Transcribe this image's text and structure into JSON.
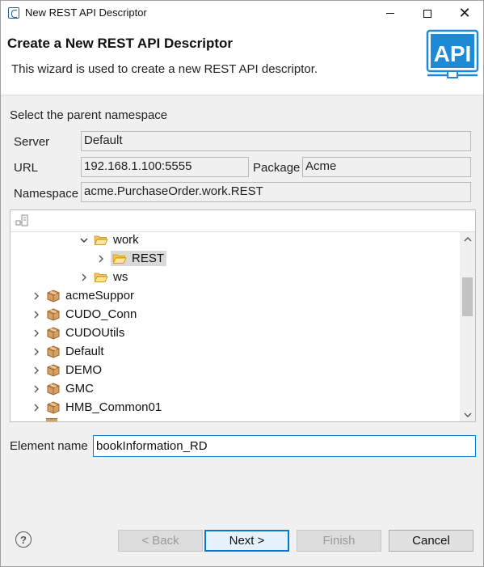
{
  "window": {
    "title": "New REST API Descriptor"
  },
  "header": {
    "title": "Create a New REST API Descriptor",
    "description": "This wizard is used to create a new REST API descriptor.",
    "logo_text": "API"
  },
  "namespace": {
    "section_label": "Select the parent namespace",
    "server_label": "Server",
    "server_value": "Default",
    "url_label": "URL",
    "url_value": "192.168.1.100:5555",
    "package_label": "Package",
    "package_value": "Acme",
    "namespace_label": "Namespace",
    "namespace_value": "acme.PurchaseOrder.work.REST"
  },
  "tree": {
    "items": [
      {
        "label": "work",
        "type": "folder",
        "expanded": true
      },
      {
        "label": "REST",
        "type": "folder",
        "expanded": false,
        "selected": true
      },
      {
        "label": "ws",
        "type": "folder",
        "expanded": false
      },
      {
        "label": "acmeSuppor",
        "type": "package"
      },
      {
        "label": "CUDO_Conn",
        "type": "package"
      },
      {
        "label": "CUDOUtils",
        "type": "package"
      },
      {
        "label": "Default",
        "type": "package"
      },
      {
        "label": "DEMO",
        "type": "package"
      },
      {
        "label": "GMC",
        "type": "package"
      },
      {
        "label": "HMB_Common01",
        "type": "package"
      }
    ]
  },
  "element": {
    "label": "Element name",
    "value": "bookInformation_RD"
  },
  "buttons": {
    "back": "< Back",
    "next": "Next >",
    "finish": "Finish",
    "cancel": "Cancel",
    "help": "?"
  },
  "colors": {
    "accent": "#0078d7",
    "logo_blue": "#1e8ad6",
    "folder": "#e9a93a",
    "package": "#c98a4b"
  }
}
